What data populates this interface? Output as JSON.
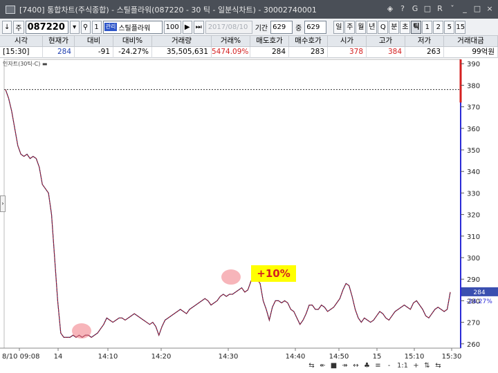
{
  "window": {
    "title": "[7400] 통합차트(주식종합) - 스틸플라워(087220 - 30 틱 - 일분식차트) - 30002740001",
    "buttons": [
      "◈",
      "?",
      "G",
      "□",
      "R",
      "ˇ",
      "_",
      "□",
      "×"
    ]
  },
  "toolbar": {
    "arrow_label": "↓",
    "mode_label": "주",
    "code": "087220",
    "tick_label": "1",
    "name_tag": "관리",
    "stock_name": "스틸플라워",
    "pct_label": "100",
    "date": "2017/08/10",
    "period_label": "기간",
    "period_value": "629",
    "count_label": "중",
    "count_value": "629",
    "periods": [
      "일",
      "주",
      "월",
      "년",
      "Q",
      "분",
      "초",
      "틱",
      "1",
      "2",
      "5",
      "15"
    ],
    "active_period": "틱"
  },
  "quote": {
    "headers": [
      "시각",
      "현재가",
      "대비",
      "대비%",
      "거래량",
      "거래%",
      "매도호가",
      "매수호가",
      "시가",
      "고가",
      "저가",
      "거래대금"
    ],
    "values": [
      "[15:30]",
      "284",
      "-91",
      "-24.27%",
      "35,505,631",
      "5474.09%",
      "284",
      "283",
      "378",
      "384",
      "263",
      "99억원"
    ],
    "colors": [
      "#000000",
      "#1f3fb0",
      "#000000",
      "#000000",
      "#000000",
      "#d42020",
      "#000000",
      "#000000",
      "#d42020",
      "#d42020",
      "#000000",
      "#000000"
    ]
  },
  "legend_text": "인자트(30틱-C) ▬",
  "annotation": "+10%",
  "price_box": {
    "current": "284",
    "change": "-24.27%"
  },
  "bottom_icons": [
    "⇆",
    "↞",
    "■",
    "↠",
    "↔",
    "♣",
    "≡",
    "-",
    "1:1",
    "+",
    "⇅",
    "⇆"
  ],
  "chart_data": {
    "type": "line",
    "ylim": [
      258,
      392
    ],
    "y_ticks": [
      260,
      270,
      280,
      290,
      300,
      310,
      320,
      330,
      340,
      350,
      360,
      370,
      380,
      390
    ],
    "x_labels": [
      "8/10 09:08",
      "14",
      "14:10",
      "14:20",
      "14:30",
      "14:40",
      "14:50",
      "15",
      "15:10",
      "15:30"
    ],
    "reference_line": 378,
    "line_color": "#cc2222",
    "series": [
      {
        "values": [
          378,
          374,
          368,
          360,
          352,
          348,
          347,
          348,
          346,
          347,
          346,
          342,
          334,
          332,
          330,
          320,
          300,
          280,
          265,
          263,
          263,
          263,
          264,
          263,
          264,
          263,
          264,
          264,
          263,
          264,
          265,
          267,
          269,
          272,
          271,
          270,
          271,
          272,
          272,
          271,
          272,
          273,
          274,
          273,
          272,
          271,
          270,
          269,
          270,
          268,
          264,
          268,
          271,
          272,
          273,
          274,
          275,
          276,
          275,
          274,
          276,
          277,
          278,
          279,
          280,
          281,
          280,
          278,
          279,
          280,
          282,
          283,
          282,
          283,
          283,
          284,
          285,
          286,
          284,
          285,
          289,
          292,
          290,
          288,
          280,
          276,
          271,
          277,
          280,
          280,
          279,
          280,
          279,
          276,
          275,
          272,
          269,
          271,
          274,
          278,
          278,
          276,
          276,
          278,
          277,
          275,
          276,
          277,
          279,
          281,
          285,
          288,
          287,
          282,
          276,
          272,
          270,
          272,
          271,
          270,
          271,
          273,
          275,
          274,
          272,
          271,
          273,
          275,
          276,
          277,
          278,
          277,
          276,
          279,
          280,
          278,
          276,
          273,
          272,
          274,
          276,
          277,
          276,
          275,
          276,
          284
        ]
      }
    ]
  }
}
